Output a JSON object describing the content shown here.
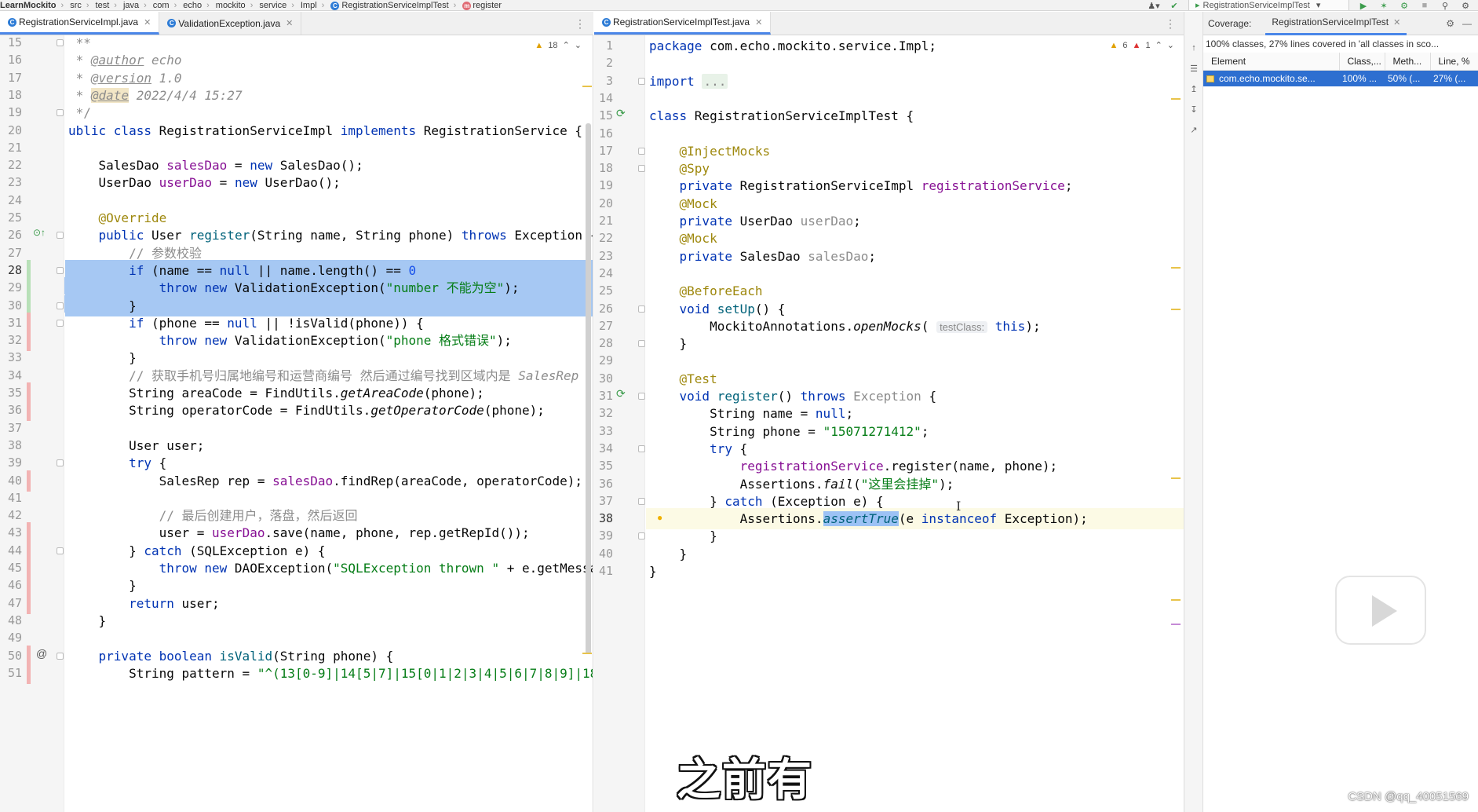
{
  "breadcrumb": [
    "LearnMockito",
    "src",
    "test",
    "java",
    "com",
    "echo",
    "mockito",
    "service",
    "Impl",
    "RegistrationServiceImplTest",
    "register"
  ],
  "run_config": "RegistrationServiceImplTest",
  "left_tabs": [
    {
      "label": "RegistrationServiceImpl.java",
      "active": true
    },
    {
      "label": "ValidationException.java",
      "active": false
    }
  ],
  "right_tabs": [
    {
      "label": "RegistrationServiceImplTest.java",
      "active": true
    }
  ],
  "left_inspection": {
    "warnings": "18"
  },
  "right_inspection": {
    "warnings": "6",
    "errors": "1"
  },
  "coverage": {
    "title": "Coverage:",
    "tab": "RegistrationServiceImplTest",
    "summary": "100% classes, 27% lines covered in 'all classes in sco...",
    "columns": [
      "Element",
      "Class,...",
      "Meth...",
      "Line, %"
    ],
    "rows": [
      [
        "com.echo.mockito.se...",
        "100% ...",
        "50% (...",
        "27% (..."
      ]
    ]
  },
  "left_code": [
    {
      "n": "15",
      "t": [
        [
          "cmtn",
          " **"
        ]
      ]
    },
    {
      "n": "16",
      "t": [
        [
          "cmt",
          " * "
        ],
        [
          "doctag",
          "@author"
        ],
        [
          "cmt",
          " echo"
        ]
      ]
    },
    {
      "n": "17",
      "t": [
        [
          "cmt",
          " * "
        ],
        [
          "doctag",
          "@version"
        ],
        [
          "cmt",
          " 1.0"
        ]
      ]
    },
    {
      "n": "18",
      "t": [
        [
          "cmt",
          " * "
        ],
        [
          "doctag dochl",
          "@date"
        ],
        [
          "cmt",
          " 2022/4/4 15:27"
        ]
      ]
    },
    {
      "n": "19",
      "t": [
        [
          "cmtn",
          " */"
        ]
      ]
    },
    {
      "n": "20",
      "t": [
        [
          "kw",
          "ublic class "
        ],
        [
          "",
          "RegistrationServiceImpl "
        ],
        [
          "kw",
          "implements "
        ],
        [
          "",
          "RegistrationService {"
        ]
      ]
    },
    {
      "n": "21",
      "t": []
    },
    {
      "n": "22",
      "t": [
        [
          "",
          "    SalesDao "
        ],
        [
          "fld",
          "salesDao"
        ],
        [
          "",
          " = "
        ],
        [
          "kw",
          "new "
        ],
        [
          "",
          "SalesDao();"
        ]
      ]
    },
    {
      "n": "23",
      "t": [
        [
          "",
          "    UserDao "
        ],
        [
          "fld",
          "userDao"
        ],
        [
          "",
          " = "
        ],
        [
          "kw",
          "new "
        ],
        [
          "",
          "UserDao();"
        ]
      ]
    },
    {
      "n": "24",
      "t": []
    },
    {
      "n": "25",
      "t": [
        [
          "ann",
          "    @Override"
        ]
      ]
    },
    {
      "n": "26",
      "t": [
        [
          "kw",
          "    public "
        ],
        [
          "",
          "User "
        ],
        [
          "mth",
          "register"
        ],
        [
          "",
          "(String name, String phone) "
        ],
        [
          "kw",
          "throws "
        ],
        [
          "",
          "Exception {"
        ]
      ]
    },
    {
      "n": "27",
      "t": [
        [
          "cmtn",
          "        // 参数校验"
        ]
      ]
    },
    {
      "n": "28",
      "t": [
        [
          "",
          "        "
        ],
        [
          "kw",
          "if "
        ],
        [
          "",
          "(name == "
        ],
        [
          "kw",
          "null "
        ],
        [
          "",
          "|| name.length() == "
        ],
        [
          "num",
          "0"
        ],
        [
          ") {"
        ]
      ]
    },
    {
      "n": "29",
      "t": [
        [
          "",
          "            "
        ],
        [
          "kw",
          "throw new "
        ],
        [
          "",
          "ValidationException("
        ],
        [
          "str",
          "\"number 不能为空\""
        ],
        [
          "",
          ");"
        ]
      ]
    },
    {
      "n": "30",
      "t": [
        [
          "",
          "        }"
        ]
      ]
    },
    {
      "n": "31",
      "t": [
        [
          "",
          "        "
        ],
        [
          "kw",
          "if "
        ],
        [
          "",
          "(phone == "
        ],
        [
          "kw",
          "null "
        ],
        [
          "",
          "|| !isValid(phone)) {"
        ]
      ]
    },
    {
      "n": "32",
      "t": [
        [
          "",
          "            "
        ],
        [
          "kw",
          "throw new "
        ],
        [
          "",
          "ValidationException("
        ],
        [
          "str",
          "\"phone 格式错误\""
        ],
        [
          "",
          ");"
        ]
      ]
    },
    {
      "n": "33",
      "t": [
        [
          "",
          "        }"
        ]
      ]
    },
    {
      "n": "34",
      "t": [
        [
          "cmtn",
          "        // 获取手机号归属地编号和运营商编号 然后通过编号找到区域内是 "
        ],
        [
          "cmt",
          "SalesRep"
        ]
      ]
    },
    {
      "n": "35",
      "t": [
        [
          "",
          "        String areaCode = FindUtils."
        ],
        [
          "itl",
          "getAreaCode"
        ],
        [
          "",
          "(phone);"
        ]
      ]
    },
    {
      "n": "36",
      "t": [
        [
          "",
          "        String operatorCode = FindUtils."
        ],
        [
          "itl",
          "getOperatorCode"
        ],
        [
          "",
          "(phone);"
        ]
      ]
    },
    {
      "n": "37",
      "t": []
    },
    {
      "n": "38",
      "t": [
        [
          "",
          "        User user;"
        ]
      ]
    },
    {
      "n": "39",
      "t": [
        [
          "kw",
          "        try "
        ],
        [
          "",
          "{"
        ]
      ]
    },
    {
      "n": "40",
      "t": [
        [
          "",
          "            SalesRep rep = "
        ],
        [
          "fld",
          "salesDao"
        ],
        [
          "",
          ".findRep(areaCode, operatorCode);"
        ]
      ]
    },
    {
      "n": "41",
      "t": []
    },
    {
      "n": "42",
      "t": [
        [
          "cmtn",
          "            // 最后创建用户，落盘，然后返回"
        ]
      ]
    },
    {
      "n": "43",
      "t": [
        [
          "",
          "            user = "
        ],
        [
          "fld",
          "userDao"
        ],
        [
          "",
          ".save(name, phone, rep.getRepId());"
        ]
      ]
    },
    {
      "n": "44",
      "t": [
        [
          "",
          "        } "
        ],
        [
          "kw",
          "catch "
        ],
        [
          "",
          "(SQLException e) {"
        ]
      ]
    },
    {
      "n": "45",
      "t": [
        [
          "",
          "            "
        ],
        [
          "kw",
          "throw new "
        ],
        [
          "",
          "DAOException("
        ],
        [
          "str",
          "\"SQLException thrown \""
        ],
        [
          "",
          " + e.getMessag"
        ]
      ]
    },
    {
      "n": "46",
      "t": [
        [
          "",
          "        }"
        ]
      ]
    },
    {
      "n": "47",
      "t": [
        [
          "kw",
          "        return "
        ],
        [
          "",
          "user;"
        ]
      ]
    },
    {
      "n": "48",
      "t": [
        [
          "",
          "    }"
        ]
      ]
    },
    {
      "n": "49",
      "t": []
    },
    {
      "n": "50",
      "t": [
        [
          "kw",
          "    private boolean "
        ],
        [
          "mth",
          "isValid"
        ],
        [
          "",
          "(String phone) {"
        ]
      ]
    },
    {
      "n": "51",
      "t": [
        [
          "",
          "        String pattern = "
        ],
        [
          "str",
          "\"^(13[0-9]|14[5|7]|15[0|1|2|3|4|5|6|7|8|9]|18["
        ]
      ]
    }
  ],
  "right_code": [
    {
      "n": "1",
      "t": [
        [
          "kw",
          "package "
        ],
        [
          "",
          "com.echo.mockito.service.Impl;"
        ]
      ]
    },
    {
      "n": "2",
      "t": []
    },
    {
      "n": "3",
      "t": [
        [
          "kw",
          "import "
        ],
        [
          "fold",
          "..."
        ]
      ]
    },
    {
      "n": "14",
      "t": []
    },
    {
      "n": "15",
      "t": [
        [
          "kw",
          "class "
        ],
        [
          "",
          "RegistrationServiceImplTest {"
        ]
      ]
    },
    {
      "n": "16",
      "t": []
    },
    {
      "n": "17",
      "t": [
        [
          "ann",
          "    @InjectMocks"
        ]
      ]
    },
    {
      "n": "18",
      "t": [
        [
          "ann",
          "    @Spy"
        ]
      ]
    },
    {
      "n": "19",
      "t": [
        [
          "kw",
          "    private "
        ],
        [
          "",
          "RegistrationServiceImpl "
        ],
        [
          "fld",
          "registrationService"
        ],
        [
          "",
          ";"
        ]
      ]
    },
    {
      "n": "20",
      "t": [
        [
          "ann",
          "    @Mock"
        ]
      ]
    },
    {
      "n": "21",
      "t": [
        [
          "kw",
          "    private "
        ],
        [
          "",
          "UserDao "
        ],
        [
          "cmtn",
          "userDao"
        ],
        [
          "",
          ";"
        ]
      ]
    },
    {
      "n": "22",
      "t": [
        [
          "ann",
          "    @Mock"
        ]
      ]
    },
    {
      "n": "23",
      "t": [
        [
          "kw",
          "    private "
        ],
        [
          "",
          "SalesDao "
        ],
        [
          "cmtn",
          "salesDao"
        ],
        [
          "",
          ";"
        ]
      ]
    },
    {
      "n": "24",
      "t": []
    },
    {
      "n": "25",
      "t": [
        [
          "ann",
          "    @BeforeEach"
        ]
      ]
    },
    {
      "n": "26",
      "t": [
        [
          "kw",
          "    void "
        ],
        [
          "mth",
          "setUp"
        ],
        [
          "",
          "() {"
        ]
      ]
    },
    {
      "n": "27",
      "t": [
        [
          "",
          "        MockitoAnnotations."
        ],
        [
          "itl",
          "openMocks"
        ],
        [
          "",
          "( "
        ],
        [
          "hint",
          "testClass:"
        ],
        [
          "",
          " "
        ],
        [
          "kw",
          "this"
        ],
        [
          "",
          ");"
        ]
      ]
    },
    {
      "n": "28",
      "t": [
        [
          "",
          "    }"
        ]
      ]
    },
    {
      "n": "29",
      "t": []
    },
    {
      "n": "30",
      "t": [
        [
          "ann",
          "    @Test"
        ]
      ]
    },
    {
      "n": "31",
      "t": [
        [
          "kw",
          "    void "
        ],
        [
          "mth",
          "register"
        ],
        [
          "",
          "() "
        ],
        [
          "kw",
          "throws "
        ],
        [
          "cmtn",
          "Exception"
        ],
        [
          "",
          " {"
        ]
      ]
    },
    {
      "n": "32",
      "t": [
        [
          "",
          "        String name = "
        ],
        [
          "kw",
          "null"
        ],
        [
          "",
          ";"
        ]
      ]
    },
    {
      "n": "33",
      "t": [
        [
          "",
          "        String phone = "
        ],
        [
          "str",
          "\"15071271412\""
        ],
        [
          "",
          ";"
        ]
      ]
    },
    {
      "n": "34",
      "t": [
        [
          "kw",
          "        try "
        ],
        [
          "",
          "{"
        ]
      ]
    },
    {
      "n": "35",
      "t": [
        [
          "",
          "            "
        ],
        [
          "fld",
          "registrationService"
        ],
        [
          "",
          ".register(name, phone);"
        ]
      ]
    },
    {
      "n": "36",
      "t": [
        [
          "",
          "            Assertions."
        ],
        [
          "itl",
          "fail"
        ],
        [
          "",
          "("
        ],
        [
          "str",
          "\"这里会挂掉\""
        ],
        [
          "",
          ");"
        ]
      ]
    },
    {
      "n": "37",
      "t": [
        [
          "",
          "        } "
        ],
        [
          "kw",
          "catch "
        ],
        [
          "",
          "(Exception e) {"
        ]
      ]
    },
    {
      "n": "38",
      "t": [
        [
          "",
          "            Assertions."
        ],
        [
          "selword mth itl",
          "assertTrue"
        ],
        [
          "",
          "(e "
        ],
        [
          "kw",
          "instanceof "
        ],
        [
          "",
          "Exception);"
        ]
      ]
    },
    {
      "n": "39",
      "t": [
        [
          "",
          "        }"
        ]
      ]
    },
    {
      "n": "40",
      "t": [
        [
          "",
          "    }"
        ]
      ]
    },
    {
      "n": "41",
      "t": [
        [
          "",
          "}"
        ]
      ]
    }
  ],
  "subtitle": "之前有",
  "watermark": "CSDN @qq_40051569"
}
